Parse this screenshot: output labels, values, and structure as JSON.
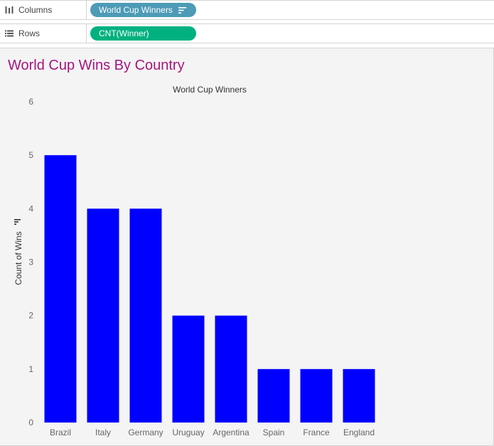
{
  "shelves": {
    "columns": {
      "label": "Columns",
      "pill": "World Cup Winners",
      "pill_color": "#4d9bb6"
    },
    "rows": {
      "label": "Rows",
      "pill": "CNT(Winner)",
      "pill_color": "#00b180"
    }
  },
  "sheet": {
    "title": "World Cup Wins By Country",
    "title_color": "#a5157e",
    "background": "#f5f4f4"
  },
  "chart_data": {
    "type": "bar",
    "title": "World Cup Winners",
    "xlabel": "",
    "ylabel": "Count of Wins",
    "categories": [
      "Brazil",
      "Italy",
      "Germany",
      "Uruguay",
      "Argentina",
      "Spain",
      "France",
      "England"
    ],
    "values": [
      5,
      4,
      4,
      2,
      2,
      1,
      1,
      1
    ],
    "ylim": [
      0,
      6
    ],
    "yticks": [
      "0",
      "1",
      "2",
      "3",
      "4",
      "5",
      "6"
    ],
    "bar_color": "#0000ff",
    "grid": false,
    "legend": "none"
  }
}
